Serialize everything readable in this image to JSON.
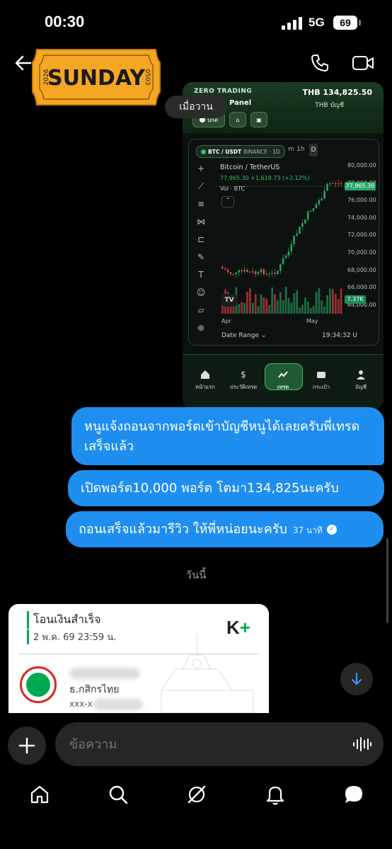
{
  "status_bar": {
    "time": "00:30",
    "network": "5G",
    "battery": "69"
  },
  "header": {
    "sticker": {
      "text": "SUNDAY",
      "left": "2026",
      "right": "0503"
    },
    "icons": [
      "back-arrow-icon",
      "phone-icon",
      "video-icon"
    ]
  },
  "attachment": {
    "brand": "ZERO TRADING",
    "panel": "Panel",
    "balance": "THB 134,825.50",
    "balance_label": "THB บัญชี",
    "status_pill": "ปกติ",
    "symbol_pill": "BTC / USDT",
    "exchange": "BINANCE · 1D",
    "timeframes": [
      "m",
      "1h",
      "D"
    ],
    "pair_name": "Bitcoin / TetherUS",
    "quote": "77,965.30  +1,618.73 (+2.12%)",
    "vol_label": "Vol · BTC",
    "y_labels": [
      "80,000.00",
      "78,000.00",
      "76,000.00",
      "74,000.00",
      "72,000.00",
      "70,000.00",
      "68,000.00",
      "66,000.00",
      "64,000.00"
    ],
    "last_price": "77,965.30",
    "vol_tag": "7.37K",
    "x_labels": [
      "Apr",
      "May"
    ],
    "date_range": "Date Range ⌄",
    "clock": "19:34:32 U",
    "tabs": [
      {
        "label": "หน้าแรก",
        "icon": "home-icon"
      },
      {
        "label": "ประวัติเทรด",
        "icon": "money-icon"
      },
      {
        "label": "เทรด",
        "icon": "chart-icon"
      },
      {
        "label": "กระเป๋า",
        "icon": "wallet-icon"
      },
      {
        "label": "บัญชี",
        "icon": "user-icon"
      }
    ]
  },
  "date_chip_yesterday": "เมื่อวาน",
  "messages": [
    {
      "text": "หนูแจ้งถอนจากพอร์ตเข้าบัญชีหนูได้เลยครับพี่เทรดเสร็จแล้ว"
    },
    {
      "text": "เปิดพอร์ต10,000 พอร์ต โตมา134,825นะครับ"
    },
    {
      "text": "ถอนเสร็จแล้วมารีวิว ให้พี่หน่อยนะครับ",
      "time": "37 นาที",
      "read": "✓"
    }
  ],
  "date_divider_today": "วันนี้",
  "receipt": {
    "title": "โอนเงินสำเร็จ",
    "date": "2 พ.ค. 69 23:59 น.",
    "logo": "K",
    "logo_plus": "+",
    "bank": "ธ.กสิกรไทย",
    "account": "xxx-x"
  },
  "composer": {
    "placeholder": "ข้อความ"
  },
  "bottom_nav": [
    "home-icon",
    "search-icon",
    "explore-icon",
    "notifications-icon",
    "messages-icon"
  ]
}
